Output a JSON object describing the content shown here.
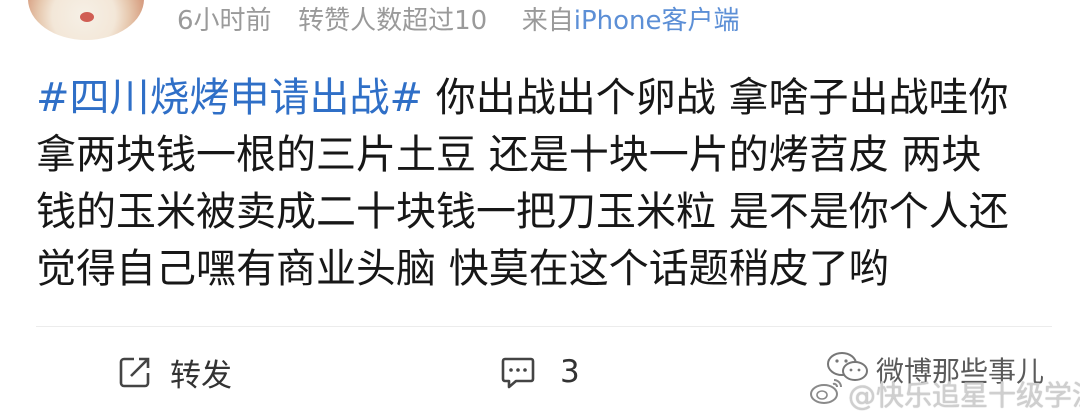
{
  "header": {
    "time": "6小时前",
    "reposts": "转赞人数超过10",
    "source_prefix": "来自",
    "source_device": "iPhone客户端"
  },
  "post": {
    "hashtag": "#四川烧烤申请出战#",
    "line1_text": " 你出战出个卵战 拿啥子出战哇你",
    "line2": "拿两块钱一根的三片土豆 还是十块一片的烤苕皮 两块",
    "line3": "钱的玉米被卖成二十块钱一把刀玉米粒 是不是你个人还",
    "line4": "觉得自己嘿有商业头脑 快莫在这个话题稍皮了哟"
  },
  "actions": {
    "repost_label": "转发",
    "comment_count": "3"
  },
  "watermarks": {
    "wechat_account": "微博那些事儿",
    "weibo_account": "@快乐追星十级学渣"
  },
  "colors": {
    "link": "#2f6fc7",
    "meta": "#9a9a9a",
    "source": "#5c8fd6"
  }
}
